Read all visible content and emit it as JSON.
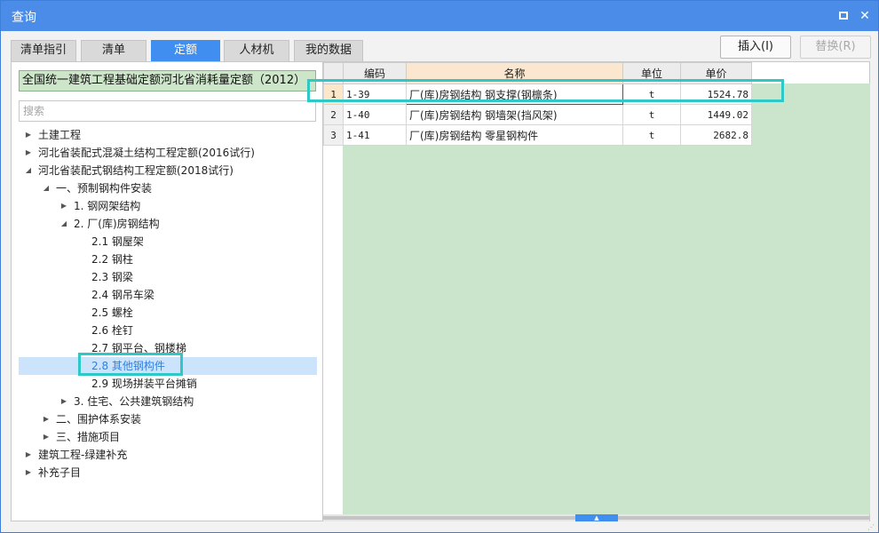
{
  "window": {
    "title": "查询",
    "maximize_icon": "maximize-icon",
    "close_icon": "close-icon",
    "close_glyph": "✕"
  },
  "tabs": [
    {
      "label": "清单指引",
      "active": false
    },
    {
      "label": "清单",
      "active": false
    },
    {
      "label": "定额",
      "active": true
    },
    {
      "label": "人材机",
      "active": false
    },
    {
      "label": "我的数据",
      "active": false
    }
  ],
  "toolbar": {
    "insert_label": "插入(I)",
    "replace_label": "替换(R)"
  },
  "left": {
    "quota_library": "全国统一建筑工程基础定额河北省消耗量定额（2012）",
    "search_placeholder": "搜索",
    "tree": [
      {
        "label": "土建工程",
        "level": 0,
        "state": "collapsed"
      },
      {
        "label": "河北省装配式混凝土结构工程定额(2016试行)",
        "level": 0,
        "state": "collapsed"
      },
      {
        "label": "河北省装配式钢结构工程定额(2018试行)",
        "level": 0,
        "state": "expanded"
      },
      {
        "label": "一、预制钢构件安装",
        "level": 1,
        "state": "expanded"
      },
      {
        "label": "1. 钢网架结构",
        "level": 2,
        "state": "collapsed"
      },
      {
        "label": "2. 厂(库)房钢结构",
        "level": 2,
        "state": "expanded"
      },
      {
        "label": "2.1 钢屋架",
        "level": 3,
        "state": "leaf"
      },
      {
        "label": "2.2 钢柱",
        "level": 3,
        "state": "leaf"
      },
      {
        "label": "2.3 钢梁",
        "level": 3,
        "state": "leaf"
      },
      {
        "label": "2.4 钢吊车梁",
        "level": 3,
        "state": "leaf"
      },
      {
        "label": "2.5 螺栓",
        "level": 3,
        "state": "leaf"
      },
      {
        "label": "2.6 栓钉",
        "level": 3,
        "state": "leaf"
      },
      {
        "label": "2.7 钢平台、钢楼梯",
        "level": 3,
        "state": "leaf"
      },
      {
        "label": "2.8 其他钢构件",
        "level": 3,
        "state": "leaf",
        "selected": true
      },
      {
        "label": "2.9 现场拼装平台摊销",
        "level": 3,
        "state": "leaf"
      },
      {
        "label": "3. 住宅、公共建筑钢结构",
        "level": 2,
        "state": "collapsed"
      },
      {
        "label": "二、围护体系安装",
        "level": 1,
        "state": "collapsed"
      },
      {
        "label": "三、措施项目",
        "level": 1,
        "state": "collapsed"
      },
      {
        "label": "建筑工程-绿建补充",
        "level": 0,
        "state": "collapsed"
      },
      {
        "label": "补充子目",
        "level": 0,
        "state": "collapsed"
      }
    ]
  },
  "grid": {
    "columns": {
      "code": "编码",
      "name": "名称",
      "unit": "单位",
      "price": "单价"
    },
    "rows": [
      {
        "num": "1",
        "code": "1-39",
        "name": "厂(库)房钢结构 钢支撑(钢檩条)",
        "unit": "t",
        "price": "1524.78"
      },
      {
        "num": "2",
        "code": "1-40",
        "name": "厂(库)房钢结构 钢墙架(挡风架)",
        "unit": "t",
        "price": "1449.02"
      },
      {
        "num": "3",
        "code": "1-41",
        "name": "厂(库)房钢结构 零星钢构件",
        "unit": "t",
        "price": "2682.8"
      }
    ]
  },
  "colors": {
    "titlebar": "#4a8ce8",
    "accent": "#3f8ef0",
    "highlight_outline": "#2ec8c6",
    "grid_background": "#cbe5cc",
    "quota_library_bg": "#cde5c9"
  }
}
